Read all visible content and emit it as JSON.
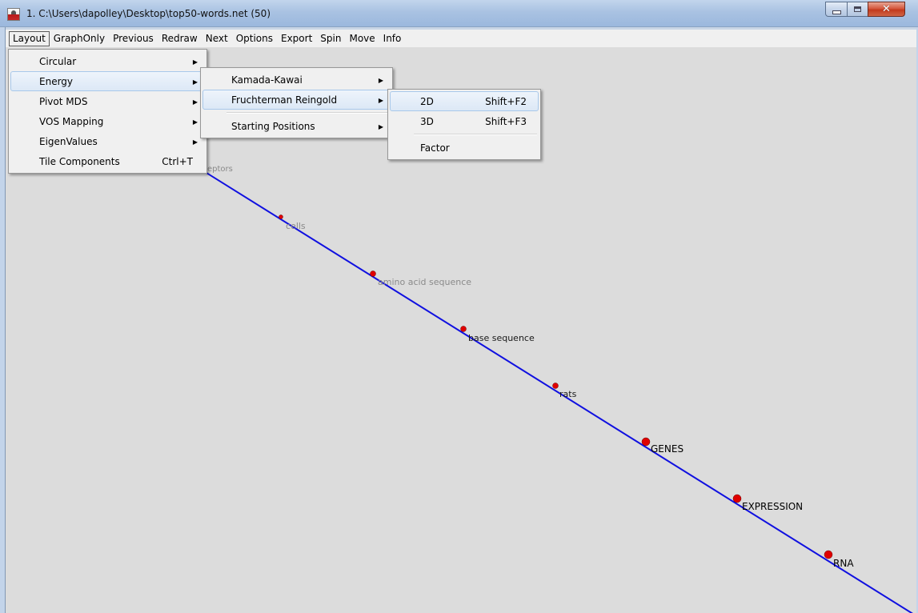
{
  "window": {
    "title": "1. C:\\Users\\dapolley\\Desktop\\top50-words.net (50)",
    "controls": {
      "minimize": "minimize",
      "maximize": "maximize",
      "close": "close"
    }
  },
  "menubar": {
    "items": [
      "Layout",
      "GraphOnly",
      "Previous",
      "Redraw",
      "Next",
      "Options",
      "Export",
      "Spin",
      "Move",
      "Info"
    ],
    "active": "Layout"
  },
  "layout_menu": {
    "items": [
      {
        "label": "Circular",
        "submenu": true
      },
      {
        "label": "Energy",
        "submenu": true,
        "highlighted": true
      },
      {
        "label": "Pivot MDS",
        "submenu": true
      },
      {
        "label": "VOS Mapping",
        "submenu": true
      },
      {
        "label": "EigenValues",
        "submenu": true
      },
      {
        "label": "Tile Components",
        "shortcut": "Ctrl+T"
      }
    ]
  },
  "energy_menu": {
    "items": [
      {
        "label": "Kamada-Kawai",
        "submenu": true
      },
      {
        "label": "Fruchterman Reingold",
        "submenu": true,
        "highlighted": true
      },
      {
        "label": "Starting Positions",
        "submenu": true
      }
    ]
  },
  "fr_menu": {
    "items": [
      {
        "label": "2D",
        "shortcut": "Shift+F2",
        "highlighted": true
      },
      {
        "label": "3D",
        "shortcut": "Shift+F3"
      },
      {
        "label": "Factor"
      }
    ]
  },
  "graph": {
    "edge_color": "#1010e0",
    "node_color": "#e00000",
    "partial_label": "eptors",
    "nodes": [
      {
        "label": "cells"
      },
      {
        "label": "amino acid sequence"
      },
      {
        "label": "base sequence"
      },
      {
        "label": "rats"
      },
      {
        "label": "GENES"
      },
      {
        "label": "EXPRESSION"
      },
      {
        "label": "RNA"
      }
    ]
  }
}
